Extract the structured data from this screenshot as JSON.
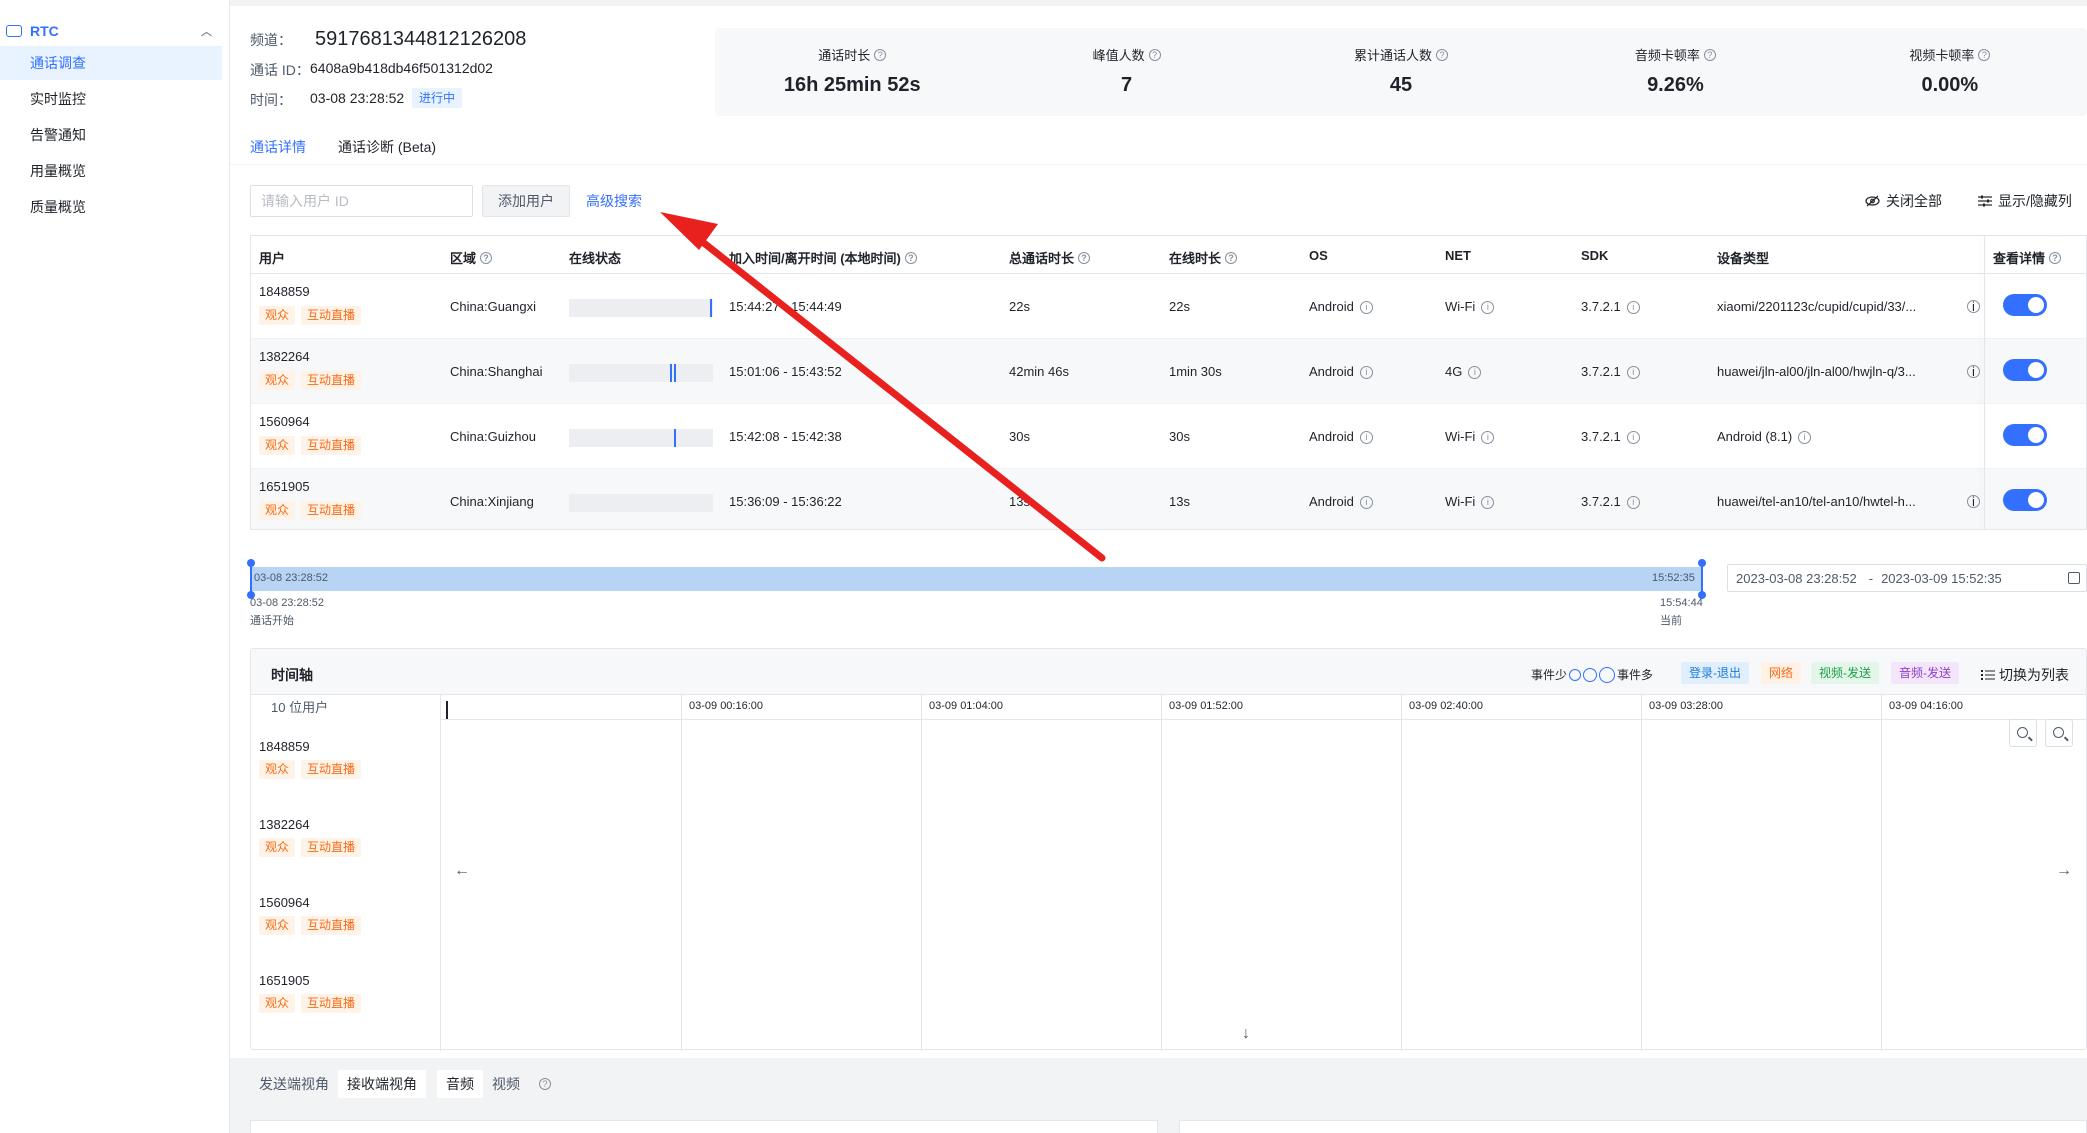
{
  "sidebar": {
    "section": "RTC",
    "items": [
      {
        "label": "通话调查",
        "active": true
      },
      {
        "label": "实时监控"
      },
      {
        "label": "告警通知"
      },
      {
        "label": "用量概览"
      },
      {
        "label": "质量概览"
      }
    ]
  },
  "header": {
    "channel_label": "频道：",
    "channel_value": "5917681344812126208",
    "call_id_label": "通话 ID：",
    "call_id_value": "6408a9b418db46f501312d02",
    "time_label": "时间：",
    "time_value": "03-08 23:28:52",
    "status_badge": "进行中",
    "stats": [
      {
        "label": "通话时长",
        "value": "16h 25min 52s"
      },
      {
        "label": "峰值人数",
        "value": "7"
      },
      {
        "label": "累计通话人数",
        "value": "45"
      },
      {
        "label": "音频卡顿率",
        "value": "9.26%"
      },
      {
        "label": "视频卡顿率",
        "value": "0.00%"
      }
    ],
    "tabs": [
      {
        "label": "通话详情",
        "active": true
      },
      {
        "label": "通话诊断 (Beta)"
      }
    ]
  },
  "toolbar": {
    "user_id_placeholder": "请输入用户 ID",
    "add_user": "添加用户",
    "advanced_search": "高级搜索",
    "close_all": "关闭全部",
    "show_hide_columns": "显示/隐藏列"
  },
  "table": {
    "columns": [
      "用户",
      "区域",
      "在线状态",
      "加入时间/离开时间 (本地时间)",
      "总通话时长",
      "在线时长",
      "OS",
      "NET",
      "SDK",
      "设备类型",
      "查看详情"
    ],
    "rows": [
      {
        "user": "1848859",
        "tags": [
          "观众",
          "互动直播"
        ],
        "region": "China:Guangxi",
        "join": "15:44:27 - 15:44:49",
        "total": "22s",
        "online": "22s",
        "os": "Android",
        "net": "Wi-Fi",
        "sdk": "3.7.2.1",
        "device": "xiaomi/2201123c/cupid/cupid/33/...",
        "marks": [
          0.99
        ],
        "details_on": true
      },
      {
        "user": "1382264",
        "tags": [
          "观众",
          "互动直播"
        ],
        "region": "China:Shanghai",
        "join": "15:01:06 - 15:43:52",
        "total": "42min 46s",
        "online": "1min 30s",
        "os": "Android",
        "net": "4G",
        "sdk": "3.7.2.1",
        "device": "huawei/jln-al00/jln-al00/hwjln-q/3...",
        "marks": [
          0.71,
          0.74
        ],
        "details_on": true
      },
      {
        "user": "1560964",
        "tags": [
          "观众",
          "互动直播"
        ],
        "region": "China:Guizhou",
        "join": "15:42:08 - 15:42:38",
        "total": "30s",
        "online": "30s",
        "os": "Android",
        "net": "Wi-Fi",
        "sdk": "3.7.2.1",
        "device": "Android (8.1)",
        "marks": [
          0.74
        ],
        "details_on": true
      },
      {
        "user": "1651905",
        "tags": [
          "观众",
          "互动直播"
        ],
        "region": "China:Xinjiang",
        "join": "15:36:09 - 15:36:22",
        "total": "13s",
        "online": "13s",
        "os": "Android",
        "net": "Wi-Fi",
        "sdk": "3.7.2.1",
        "device": "huawei/tel-an10/tel-an10/hwtel-h...",
        "marks": [],
        "details_on": true
      }
    ]
  },
  "range": {
    "start_inner": "03-08 23:28:52",
    "end_inner": "15:52:35",
    "start_below": "03-08 23:28:52",
    "start_caption": "通话开始",
    "end_below": "15:54:44",
    "end_caption": "当前",
    "picker_start": "2023-03-08 23:28:52",
    "picker_sep": "-",
    "picker_end": "2023-03-09 15:52:35"
  },
  "timeline": {
    "title": "时间轴",
    "events_less": "事件少",
    "events_more": "事件多",
    "legend": [
      {
        "label": "登录-退出",
        "color": "#1b7bd6",
        "bg": "#e1effd"
      },
      {
        "label": "网络",
        "color": "#f76b15",
        "bg": "#fff1e6"
      },
      {
        "label": "视频-发送",
        "color": "#1f9d4a",
        "bg": "#e3f6e9"
      },
      {
        "label": "音频-发送",
        "color": "#8f3cc9",
        "bg": "#f3e6fb"
      }
    ],
    "switch_list": "切换为列表",
    "users_count": "10 位用户",
    "ticks": [
      "03-09 00:16:00",
      "03-09 01:04:00",
      "03-09 01:52:00",
      "03-09 02:40:00",
      "03-09 03:28:00",
      "03-09 04:16:00"
    ],
    "users": [
      {
        "id": "1848859",
        "tags": [
          "观众",
          "互动直播"
        ]
      },
      {
        "id": "1382264",
        "tags": [
          "观众",
          "互动直播"
        ]
      },
      {
        "id": "1560964",
        "tags": [
          "观众",
          "互动直播"
        ]
      },
      {
        "id": "1651905",
        "tags": [
          "观众",
          "互动直播"
        ]
      }
    ]
  },
  "bottom": {
    "perspective": [
      "发送端视角",
      "接收端视角"
    ],
    "media": [
      "音频",
      "视频"
    ]
  }
}
